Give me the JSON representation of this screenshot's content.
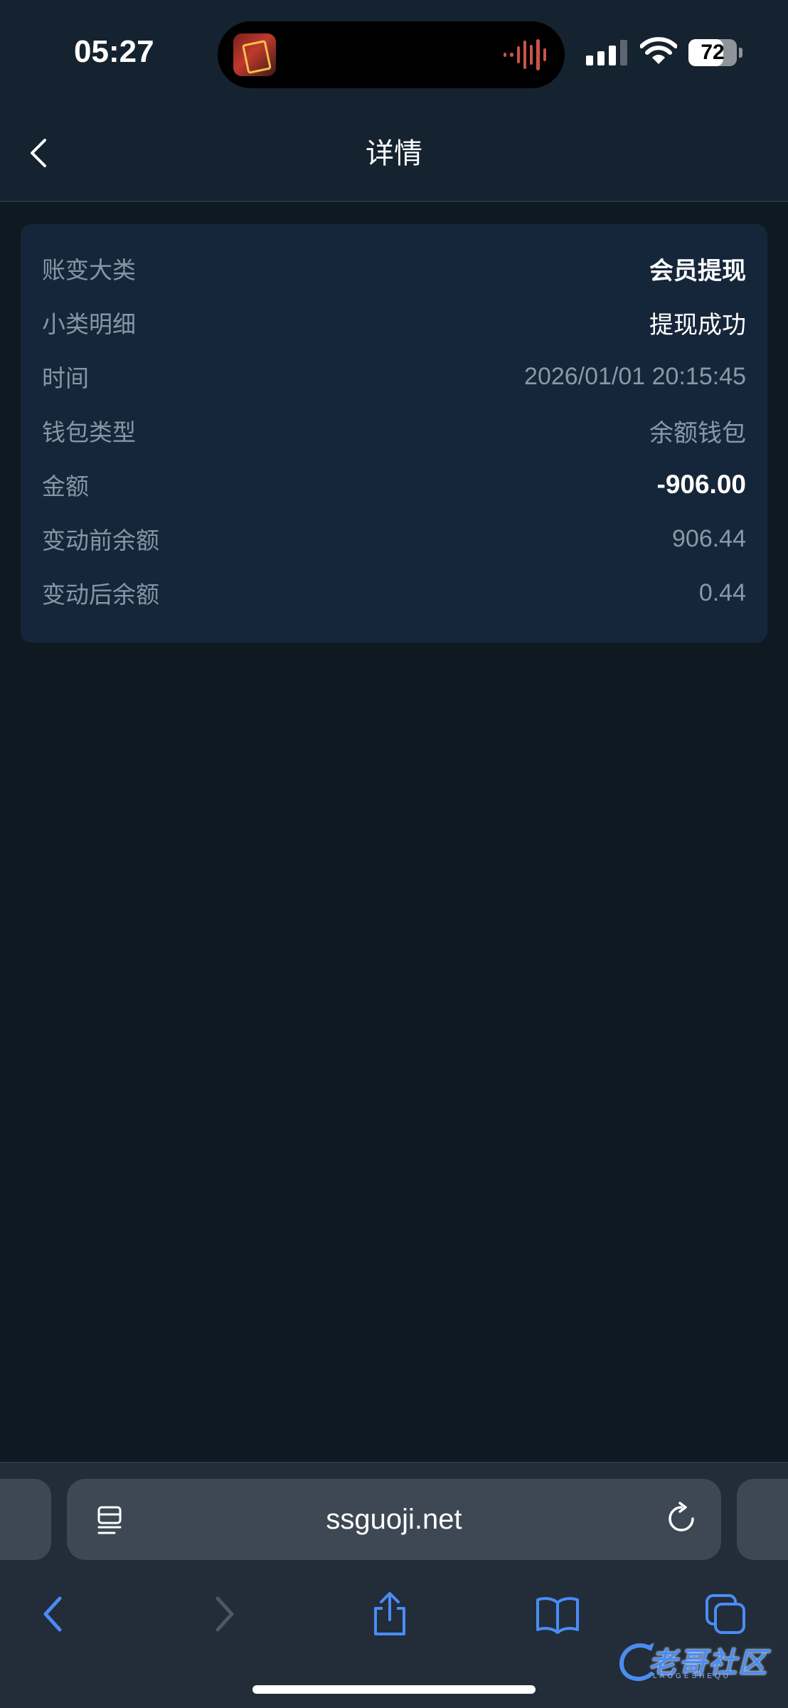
{
  "status_bar": {
    "time": "05:27",
    "battery": "72",
    "battery_level": 0.72,
    "signal_bars": 3,
    "icons": [
      "app-icon",
      "waveform-icon",
      "signal-icon",
      "wifi-icon",
      "battery-icon"
    ]
  },
  "header": {
    "title": "详情",
    "back_icon": "chevron-left-icon"
  },
  "details": {
    "rows": [
      {
        "label": "账变大类",
        "value": "会员提现"
      },
      {
        "label": "小类明细",
        "value": "提现成功"
      },
      {
        "label": "时间",
        "value": "2026/01/01 20:15:45"
      },
      {
        "label": "钱包类型",
        "value": "余额钱包"
      },
      {
        "label": "金额",
        "value": "-906.00"
      },
      {
        "label": "变动前余额",
        "value": "906.44"
      },
      {
        "label": "变动后余额",
        "value": "0.44"
      }
    ]
  },
  "browser": {
    "url": "ssguoji.net",
    "icons": [
      "reader-icon",
      "reload-icon",
      "back-icon",
      "forward-icon",
      "share-icon",
      "bookmarks-icon",
      "tabs-icon"
    ]
  },
  "watermark": {
    "text": "老哥社区",
    "sub": "LAOGESHEQU"
  },
  "colors": {
    "background": "#0e1922",
    "header": "#15222f",
    "card": "#16263a",
    "accent": "#4a8cf5"
  }
}
